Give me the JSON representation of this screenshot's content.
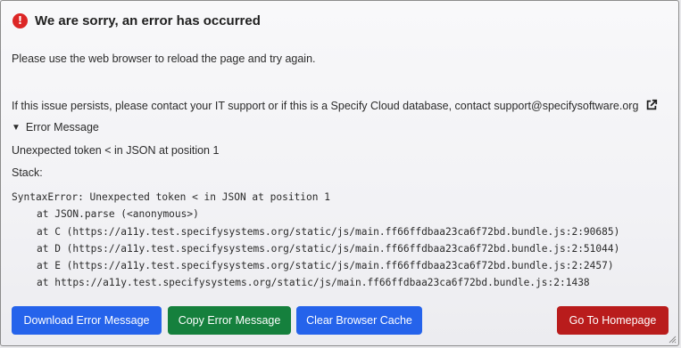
{
  "dialog": {
    "title": "We are sorry, an error has occurred",
    "title_icon": "exclamation-circle-icon",
    "reload_message": "Please use the web browser to reload the page and try again.",
    "support_message": "If this issue persists, please contact your IT support or if this is a Specify Cloud database, contact ",
    "support_email": "support@specifysoftware.org",
    "details_summary": "Error Message",
    "error_text": "Unexpected token < in JSON at position 1",
    "stack_label": "Stack:",
    "stack_lines": [
      "SyntaxError: Unexpected token < in JSON at position 1",
      "at JSON.parse (<anonymous>)",
      "at C (https://a11y.test.specifysystems.org/static/js/main.ff66ffdbaa23ca6f72bd.bundle.js:2:90685)",
      "at D (https://a11y.test.specifysystems.org/static/js/main.ff66ffdbaa23ca6f72bd.bundle.js:2:51044)",
      "at E (https://a11y.test.specifysystems.org/static/js/main.ff66ffdbaa23ca6f72bd.bundle.js:2:2457)",
      "at https://a11y.test.specifysystems.org/static/js/main.ff66ffdbaa23ca6f72bd.bundle.js:2:1438"
    ]
  },
  "buttons": {
    "download": "Download Error Message",
    "copy": "Copy Error Message",
    "clear_cache": "Clear Browser Cache",
    "home": "Go To Homepage"
  },
  "colors": {
    "primary": "#2563eb",
    "success": "#15803d",
    "danger": "#b91c1c",
    "error_icon": "#dc2626"
  }
}
